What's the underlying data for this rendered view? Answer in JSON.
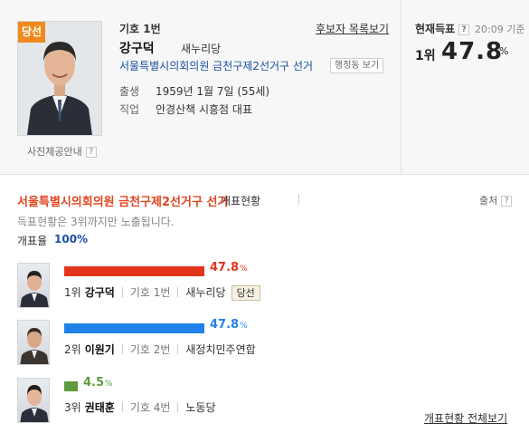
{
  "winner_badge": "당선",
  "photo_note": "사진제공안내",
  "help_mark": "?",
  "candidate": {
    "symbol": "기호 1번",
    "list_link": "후보자 목록보기",
    "name": "강구덕",
    "party": "새누리당",
    "district": "서울특별시의회의원 금천구제2선거구 선거",
    "district_button": "행정동 보기",
    "birth_label": "출생",
    "birth_value": "1959년 1월 7일 (55세)",
    "job_label": "직업",
    "job_value": "안경산책 시흥점 대표"
  },
  "current": {
    "label": "현재득표",
    "time": "20:09 기준",
    "rank": "1위",
    "percent": "47.8",
    "unit": "%"
  },
  "section": {
    "title": "서울특별시의회의원 금천구제2선거구 선거",
    "subtitle": "개표현황",
    "source": "출처",
    "note": "득표현황은 3위까지만 노출됩니다.",
    "rate_label": "개표율",
    "rate_value": "100%"
  },
  "results": [
    {
      "rank": "1위",
      "name": "강구덕",
      "symbol": "기호 1번",
      "party": "새누리당",
      "percent": "47.8",
      "share": 47.8,
      "color": "#e2341d",
      "tag": "당선"
    },
    {
      "rank": "2위",
      "name": "이원기",
      "symbol": "기호 2번",
      "party": "새정치민주연합",
      "percent": "47.8",
      "share": 47.8,
      "color": "#1f82e8",
      "tag": ""
    },
    {
      "rank": "3위",
      "name": "권태훈",
      "symbol": "기호 4번",
      "party": "노동당",
      "percent": "4.5",
      "share": 4.5,
      "color": "#5e9a3e",
      "tag": ""
    }
  ],
  "percent_unit": "%",
  "all_results_link": "개표현황 전체보기",
  "icons": [
    "person-photo",
    "question-icon"
  ]
}
